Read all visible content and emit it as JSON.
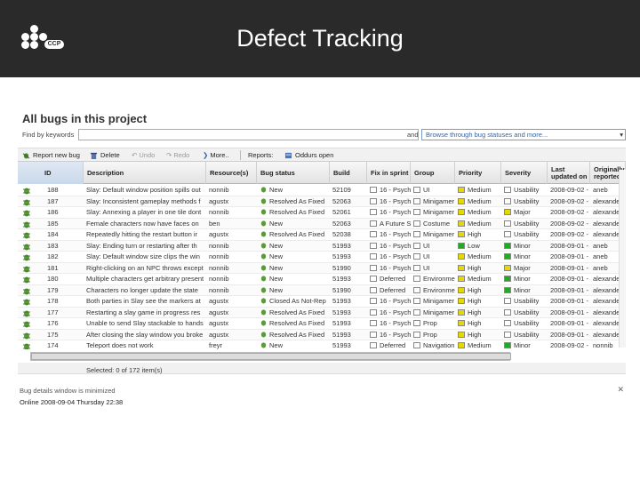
{
  "slide": {
    "title": "Defect Tracking",
    "logo_text": "CCP"
  },
  "app": {
    "title": "All bugs in this project",
    "find_label": "Find by keywords",
    "find_value": "",
    "and_label": "and",
    "browse_value": "Browse through bug statuses and more...",
    "toolbar": {
      "report_new": "Report new bug",
      "delete": "Delete",
      "undo": "Undo",
      "redo": "Redo",
      "more": "More..",
      "reports": "Reports:",
      "oddurs": "Oddurs open"
    },
    "columns": [
      "ID",
      "Description",
      "Resource(s)",
      "Bug status",
      "Build",
      "Fix in sprint",
      "Group",
      "Priority",
      "Severity",
      "Last updated on",
      "Originally reported"
    ],
    "rows": [
      {
        "id": "188",
        "desc": "Slay: Default window position spills out",
        "res": "nonnib",
        "status": "New",
        "build": "52109",
        "sprint": "16 - Psych",
        "group": "UI",
        "priority": "Medium",
        "severity": "Usability",
        "updated": "2008-09-02 -",
        "reporter": "aneb"
      },
      {
        "id": "187",
        "desc": "Slay: Inconsistent gameplay methods f",
        "res": "agustx",
        "status": "Resolved As Fixed",
        "build": "52063",
        "sprint": "16 - Psych",
        "group": "Minigamer",
        "priority": "Medium",
        "severity": "Usability",
        "updated": "2008-09-02 -",
        "reporter": "alexander"
      },
      {
        "id": "186",
        "desc": "Slay: Annexing a player in one tile dont",
        "res": "nonnib",
        "status": "Resolved As Fixed",
        "build": "52061",
        "sprint": "16 - Psych",
        "group": "Minigamer",
        "priority": "Medium",
        "severity": "Major",
        "updated": "2008-09-02 -",
        "reporter": "alexander"
      },
      {
        "id": "185",
        "desc": "Female characters now have faces on",
        "res": "ben",
        "status": "New",
        "build": "52063",
        "sprint": "A Future S",
        "group": "Costume",
        "priority": "Medium",
        "severity": "Usability",
        "updated": "2008-09-02 -",
        "reporter": "alexander"
      },
      {
        "id": "184",
        "desc": "Repeatedly hitting the restart button ir",
        "res": "agustx",
        "status": "Resolved As Fixed",
        "build": "52038",
        "sprint": "16 - Psych",
        "group": "Minigamer",
        "priority": "High",
        "severity": "Usability",
        "updated": "2008-09-02 -",
        "reporter": "alexander"
      },
      {
        "id": "183",
        "desc": "Slay: Ending turn or restarting after th",
        "res": "nonnib",
        "status": "New",
        "build": "51993",
        "sprint": "16 - Psych",
        "group": "UI",
        "priority": "Low",
        "severity": "Minor",
        "updated": "2008-09-01 -",
        "reporter": "aneb"
      },
      {
        "id": "182",
        "desc": "Slay: Default window size clips the win",
        "res": "nonnib",
        "status": "New",
        "build": "51993",
        "sprint": "16 - Psych",
        "group": "UI",
        "priority": "Medium",
        "severity": "Minor",
        "updated": "2008-09-01 -",
        "reporter": "aneb"
      },
      {
        "id": "181",
        "desc": "Right-clicking on an NPC throws except",
        "res": "nonnib",
        "status": "New",
        "build": "51990",
        "sprint": "16 - Psych",
        "group": "UI",
        "priority": "High",
        "severity": "Major",
        "updated": "2008-09-01 -",
        "reporter": "aneb"
      },
      {
        "id": "180",
        "desc": "Multiple characters get arbitrary present",
        "res": "nonnib",
        "status": "New",
        "build": "51993",
        "sprint": "Deferred",
        "group": "Environme",
        "priority": "Medium",
        "severity": "Minor",
        "updated": "2008-09-01 -",
        "reporter": "alexander"
      },
      {
        "id": "179",
        "desc": "Characters no longer update the state",
        "res": "nonnib",
        "status": "New",
        "build": "51990",
        "sprint": "Deferred",
        "group": "Environme",
        "priority": "High",
        "severity": "Minor",
        "updated": "2008-09-01 -",
        "reporter": "alexander"
      },
      {
        "id": "178",
        "desc": "Both parties in Slay see the markers at",
        "res": "agustx",
        "status": "Closed As Not-Rep",
        "build": "51993",
        "sprint": "16 - Psych",
        "group": "Minigamer",
        "priority": "High",
        "severity": "Usability",
        "updated": "2008-09-01 -",
        "reporter": "alexander"
      },
      {
        "id": "177",
        "desc": "Restarting a slay game in progress res",
        "res": "agustx",
        "status": "Resolved As Fixed",
        "build": "51993",
        "sprint": "16 - Psych",
        "group": "Minigamer",
        "priority": "High",
        "severity": "Usability",
        "updated": "2008-09-01 -",
        "reporter": "alexander"
      },
      {
        "id": "176",
        "desc": "Unable to send Slay stackable to hands",
        "res": "agustx",
        "status": "Resolved As Fixed",
        "build": "51993",
        "sprint": "16 - Psych",
        "group": "Prop",
        "priority": "High",
        "severity": "Usability",
        "updated": "2008-09-01 -",
        "reporter": "alexander"
      },
      {
        "id": "175",
        "desc": "After closing the slay window you broke",
        "res": "agustx",
        "status": "Resolved As Fixed",
        "build": "51993",
        "sprint": "16 - Psych",
        "group": "Prop",
        "priority": "High",
        "severity": "Usability",
        "updated": "2008-09-01 -",
        "reporter": "alexander"
      },
      {
        "id": "174",
        "desc": "Teleport does not work",
        "res": "freyr",
        "status": "New",
        "build": "51993",
        "sprint": "Deferred",
        "group": "Navigation",
        "priority": "Medium",
        "severity": "Minor",
        "updated": "2008-09-02 -",
        "reporter": "nonnib"
      }
    ],
    "selected_text": "Selected: 0 of 172 item(s)",
    "minimized_text": "Bug details window is minimized",
    "online_text": "Online 2008-09-04 Thursday 22:38",
    "colors": {
      "priority_medium": "#e6d800",
      "priority_high": "#e6d800",
      "priority_low": "#22aa22",
      "severity_minor": "#22aa22",
      "severity_major": "#e6d800",
      "severity_usability": "#ffffff"
    }
  }
}
